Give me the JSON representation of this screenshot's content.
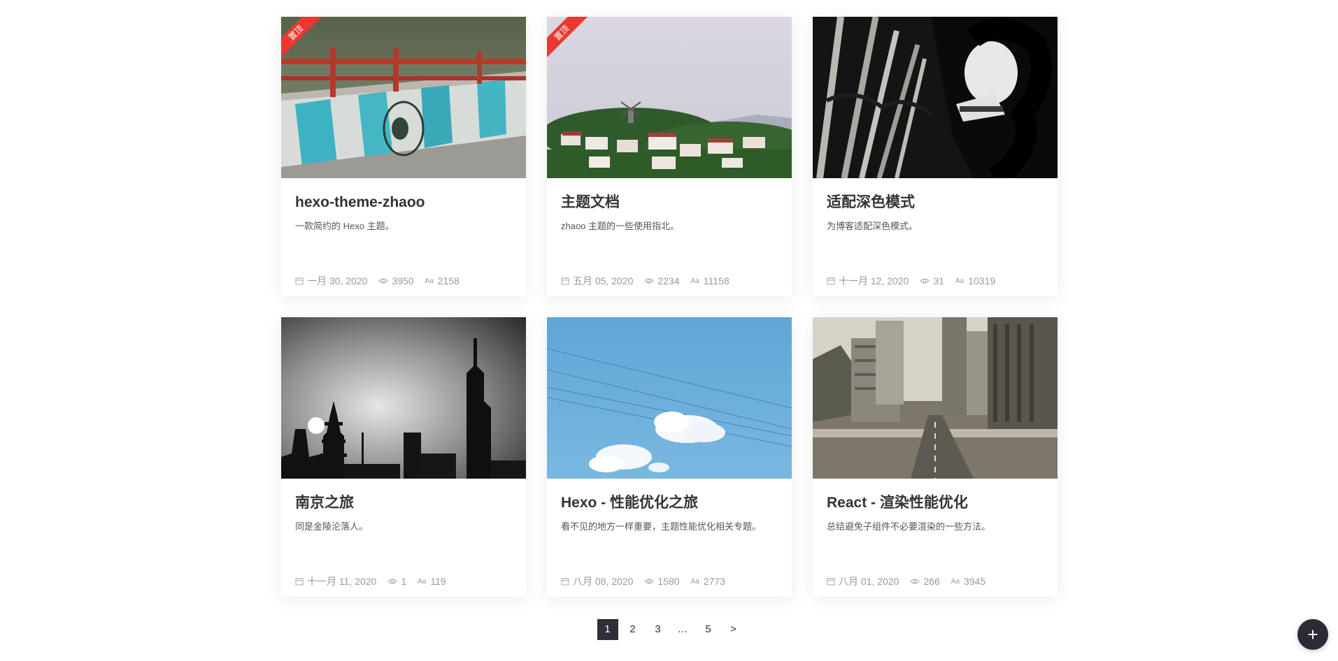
{
  "posts": [
    {
      "sticky": true,
      "sticky_label": "置顶",
      "title": "hexo-theme-zhaoo",
      "desc": "一款简约的 Hexo 主题。",
      "date": "一月 30, 2020",
      "views": "3950",
      "words": "2158"
    },
    {
      "sticky": true,
      "sticky_label": "置顶",
      "title": "主题文档",
      "desc": "zhaoo 主题的一些使用指北。",
      "date": "五月 05, 2020",
      "views": "2234",
      "words": "11158"
    },
    {
      "sticky": false,
      "title": "适配深色模式",
      "desc": "为博客适配深色模式。",
      "date": "十一月 12, 2020",
      "views": "31",
      "words": "10319"
    },
    {
      "sticky": false,
      "title": "南京之旅",
      "desc": "同是金陵沦落人。",
      "date": "十一月 11, 2020",
      "views": "1",
      "words": "119"
    },
    {
      "sticky": false,
      "title": "Hexo - 性能优化之旅",
      "desc": "看不见的地方一样重要，主题性能优化相关专题。",
      "date": "八月 08, 2020",
      "views": "1580",
      "words": "2773"
    },
    {
      "sticky": false,
      "title": "React - 渲染性能优化",
      "desc": "总结避免子组件不必要渲染的一些方法。",
      "date": "八月 01, 2020",
      "views": "266",
      "words": "3945"
    }
  ],
  "word_icon_label": "Aa",
  "pagination": {
    "pages": [
      "1",
      "2",
      "3",
      "…",
      "5"
    ],
    "current": "1",
    "next_label": ">"
  },
  "fab_label": "+"
}
